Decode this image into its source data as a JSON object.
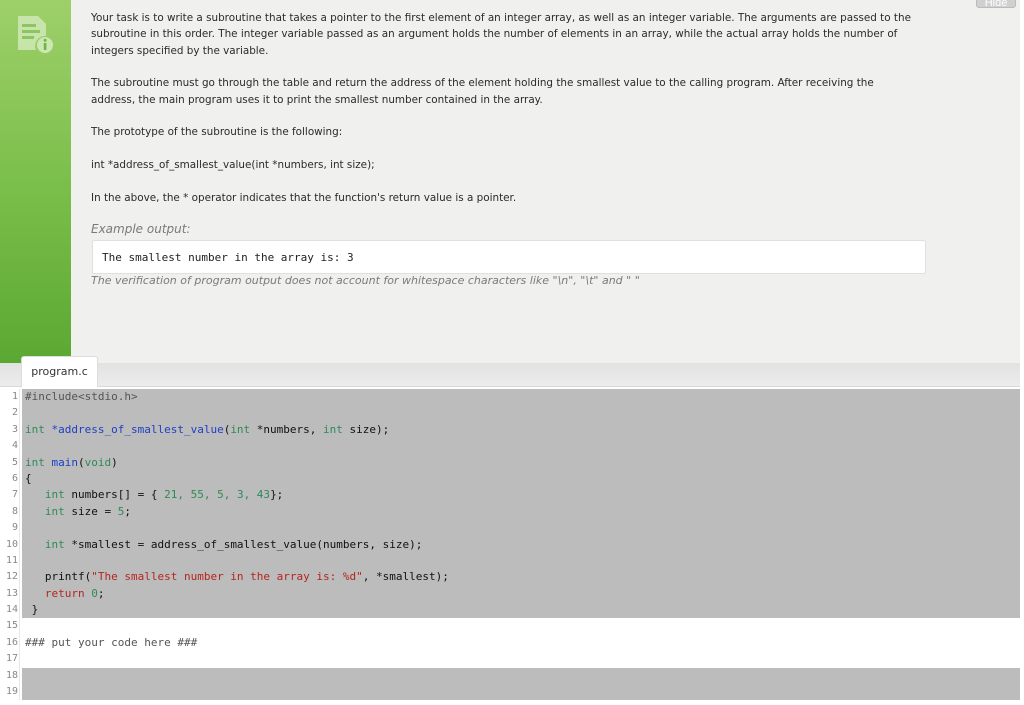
{
  "task": {
    "hide_label": "Hide",
    "paragraphs": [
      "Your task is to write a subroutine that takes a pointer to the first element of an integer array, as well as an integer variable. The arguments are passed to the subroutine in this order. The integer variable passed as an argument holds the number of elements in an array, while the actual array holds the number of integers specified by the variable.",
      "The subroutine must go through the table and return the address of the element holding the smallest value to the calling program. After receiving the address, the main program uses it to print the smallest number contained in the array.",
      "The prototype of the subroutine is the following:",
      "int *address_of_smallest_value(int *numbers, int size);",
      "In the above, the * operator indicates that the function's return value is a pointer."
    ],
    "example_label": "Example output:",
    "example_output": "The smallest number in the array is: 3",
    "verification_note": "The verification of program output does not account for whitespace characters like \"\\n\", \"\\t\" and \" \""
  },
  "editor": {
    "tab_name": "program.c",
    "line_numbers": [
      "1",
      "2",
      "3",
      "4",
      "5",
      "6",
      "7",
      "8",
      "9",
      "10",
      "11",
      "12",
      "13",
      "14",
      "15",
      "16",
      "17",
      "18",
      "19"
    ],
    "code": {
      "l1": "#include<stdio.h>",
      "l3_kw": "int",
      "l3_fn": "*address_of_smallest_value",
      "l3_p1": "(",
      "l3_kw2": "int",
      "l3_p2": " *numbers, ",
      "l3_kw3": "int",
      "l3_p3": " size);",
      "l5_kw": "int",
      "l5_fn": "main",
      "l5_p1": "(",
      "l5_kw2": "void",
      "l5_p2": ")",
      "l6": "{",
      "l7_kw": "int",
      "l7_p1": " numbers[] = { ",
      "l7_nums": "21, 55, 5, 3, 43",
      "l7_p2": "};",
      "l8_kw": "int",
      "l8_p1": " size = ",
      "l8_num": "5",
      "l8_p2": ";",
      "l10_kw": "int",
      "l10_p1": " *smallest = address_of_smallest_value(numbers, size);",
      "l12_p1": "printf(",
      "l12_str": "\"The smallest number in the array is: %d\"",
      "l12_p2": ", *smallest);",
      "l13_kw": "return",
      "l13_num": "0",
      "l13_p2": ";",
      "l14": "}",
      "l16": "### put your code here ###"
    }
  }
}
